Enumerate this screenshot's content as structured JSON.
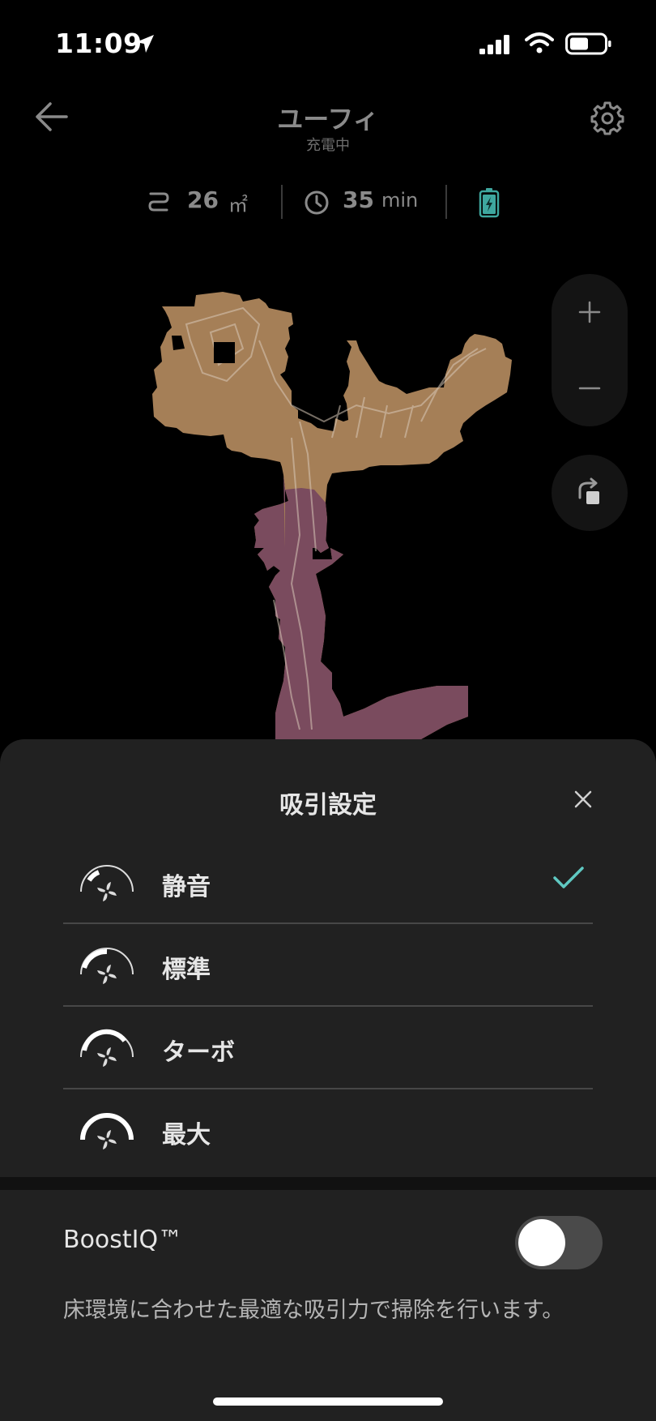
{
  "status_bar": {
    "time": "11:09",
    "icons": [
      "location-arrow-icon",
      "cellular-signal-icon",
      "wifi-icon",
      "battery-icon"
    ]
  },
  "header": {
    "title": "ユーフィ",
    "status": "充電中",
    "back_icon": "arrow-left-icon",
    "settings_icon": "gear-icon"
  },
  "stats": {
    "area_value": "26",
    "area_unit": "㎡",
    "time_value": "35",
    "time_unit": "min",
    "icons": [
      "cleaning-path-icon",
      "clock-icon",
      "battery-charging-icon"
    ]
  },
  "map_controls": {
    "zoom_in_icon": "plus-icon",
    "zoom_out_icon": "minus-icon",
    "rotate_icon": "rotate-icon"
  },
  "colors": {
    "background": "#000000",
    "sheet": "#212121",
    "room_a": "#a57f57",
    "room_b": "#7a4b5e",
    "accent_check": "#5fc9c2",
    "battery_green": "#3ea79f"
  },
  "suction_sheet": {
    "title": "吸引設定",
    "close_icon": "close-icon",
    "selected": "静音",
    "options": [
      {
        "label": "静音",
        "icon": "fan-quiet-icon"
      },
      {
        "label": "標準",
        "icon": "fan-standard-icon"
      },
      {
        "label": "ターボ",
        "icon": "fan-turbo-icon"
      },
      {
        "label": "最大",
        "icon": "fan-max-icon"
      }
    ]
  },
  "boost": {
    "label": "BoostIQ™",
    "enabled": false,
    "description": "床環境に合わせた最適な吸引力で掃除を行います。"
  }
}
